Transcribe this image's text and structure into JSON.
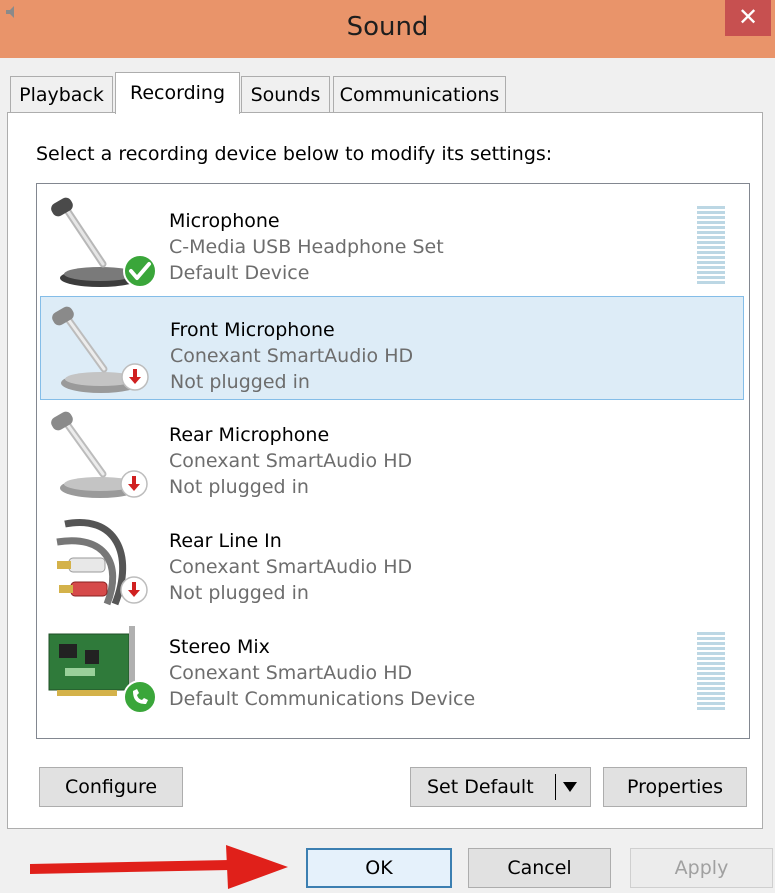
{
  "window": {
    "title": "Sound",
    "close_glyph": "✕"
  },
  "tabs": [
    {
      "label": "Playback",
      "active": false
    },
    {
      "label": "Recording",
      "active": true
    },
    {
      "label": "Sounds",
      "active": false
    },
    {
      "label": "Communications",
      "active": false
    }
  ],
  "instruction": "Select a recording device below to modify its settings:",
  "devices": [
    {
      "name": "Microphone",
      "driver": "C-Media USB Headphone Set",
      "status": "Default Device",
      "icon": "microphone-icon",
      "badge": "default-check-badge",
      "selected": false,
      "has_meter": true
    },
    {
      "name": "Front Microphone",
      "driver": "Conexant SmartAudio HD",
      "status": "Not plugged in",
      "icon": "microphone-icon",
      "badge": "unplugged-badge",
      "selected": true,
      "has_meter": false
    },
    {
      "name": "Rear Microphone",
      "driver": "Conexant SmartAudio HD",
      "status": "Not plugged in",
      "icon": "microphone-icon",
      "badge": "unplugged-badge",
      "selected": false,
      "has_meter": false
    },
    {
      "name": "Rear Line In",
      "driver": "Conexant SmartAudio HD",
      "status": "Not plugged in",
      "icon": "rca-cable-icon",
      "badge": "unplugged-badge",
      "selected": false,
      "has_meter": false
    },
    {
      "name": "Stereo Mix",
      "driver": "Conexant SmartAudio HD",
      "status": "Default Communications Device",
      "icon": "sound-card-icon",
      "badge": "communications-phone-badge",
      "selected": false,
      "has_meter": true
    }
  ],
  "buttons": {
    "configure": "Configure",
    "set_default": "Set Default",
    "properties": "Properties",
    "ok": "OK",
    "cancel": "Cancel",
    "apply": "Apply"
  },
  "colors": {
    "titlebar": "#e9946a",
    "close": "#c75050",
    "selection_bg": "#ddecf7",
    "selection_border": "#84bde8",
    "check_green": "#3aa63a",
    "unplugged_red": "#d02020",
    "annotation_arrow": "#e0201a"
  }
}
